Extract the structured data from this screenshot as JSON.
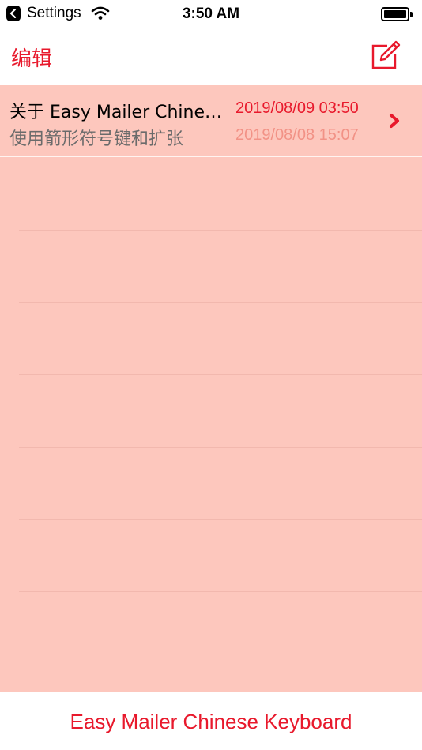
{
  "status_bar": {
    "back_app": "Settings",
    "time": "3:50 AM",
    "icons": [
      "back-chevron-icon",
      "wifi-icon",
      "battery-icon"
    ]
  },
  "nav": {
    "edit_label": "编辑",
    "compose_icon": "compose-icon"
  },
  "colors": {
    "accent": "#e8192c",
    "list_background": "#fdc7bd",
    "secondary_date": "#f29286"
  },
  "list": {
    "items": [
      {
        "title": "关于 Easy Mailer Chinese Keyboard",
        "subtitle": "使用箭形符号键和扩张",
        "date_primary": "2019/08/09 03:50",
        "date_secondary": "2019/08/08 15:07",
        "icon": "chevron-right-icon"
      }
    ]
  },
  "bottom_bar": {
    "title": "Easy Mailer Chinese Keyboard"
  }
}
